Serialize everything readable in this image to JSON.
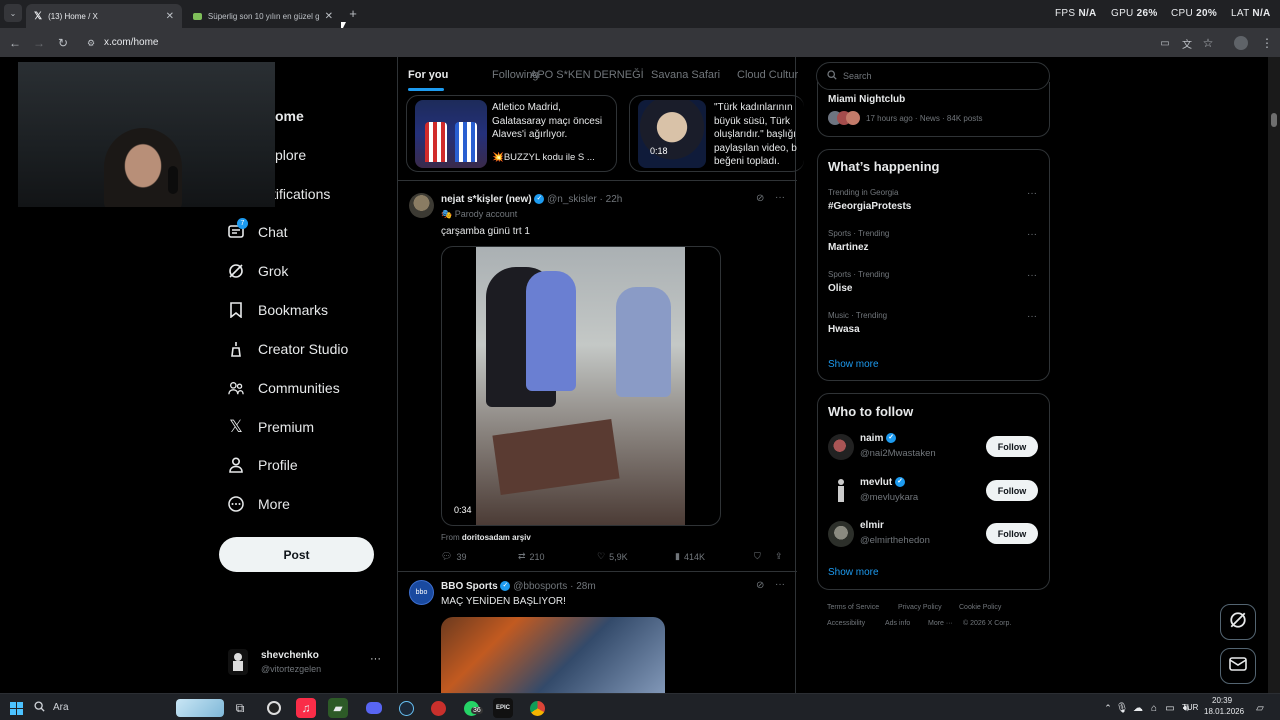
{
  "browser": {
    "tabs": [
      {
        "title": "(13) Home / X",
        "active": true
      },
      {
        "title": "Süperlig son 10 yılın en güzel g",
        "active": false
      }
    ],
    "new_tab": "+",
    "url": "x.com/home",
    "perf": {
      "fps_label": "FPS",
      "fps_value": "N/A",
      "gpu_label": "GPU",
      "gpu_value": "26%",
      "cpu_label": "CPU",
      "cpu_value": "20%",
      "lat_label": "LAT",
      "lat_value": "N/A"
    }
  },
  "nav": {
    "items": [
      {
        "label": "Home",
        "icon": "home-icon"
      },
      {
        "label": "Explore",
        "icon": "search-icon"
      },
      {
        "label": "Notifications",
        "icon": "bell-icon"
      },
      {
        "label": "Chat",
        "icon": "chat-icon"
      },
      {
        "label": "Grok",
        "icon": "grok-icon"
      },
      {
        "label": "Bookmarks",
        "icon": "bookmark-icon"
      },
      {
        "label": "Creator Studio",
        "icon": "creator-icon"
      },
      {
        "label": "Communities",
        "icon": "communities-icon"
      },
      {
        "label": "Premium",
        "icon": "x-logo-icon"
      },
      {
        "label": "Profile",
        "icon": "person-icon"
      },
      {
        "label": "More",
        "icon": "more-circle-icon"
      }
    ],
    "visible_labels": {
      "home": "ome",
      "explore": "plore",
      "notifications": "tifications"
    },
    "chat_badge": "7",
    "post_label": "Post",
    "account": {
      "name": "shevchenko",
      "handle": "@vitortezgelen"
    }
  },
  "feed": {
    "tabs": [
      "For you",
      "Following",
      "APO S*KEN DERNEĞİ",
      "Savana Safari",
      "Cloud Cultur"
    ],
    "cards": [
      {
        "text": "Atletico Madrid, Galatasaray maçı öncesi Alaves'i ağırlıyor.",
        "sub": "💥BUZZYL kodu ile S ..."
      },
      {
        "text": "\"Türk kadınlarının büyük süsü, Türk oluşlarıdır.\" başlığı paylaşılan video, b beğeni topladı.",
        "duration": "0:18"
      }
    ],
    "tweets": [
      {
        "name": "nejat s*kişler (new)",
        "handle": "@n_skisler",
        "time": "· 22h",
        "parody": "Parody account",
        "text": "çarşamba günü trt 1",
        "video_duration": "0:34",
        "from_label": "From",
        "from_user": "doritosadam arşiv",
        "replies": "39",
        "reposts": "210",
        "likes": "5,9K",
        "views": "414K"
      },
      {
        "name": "BBO Sports",
        "handle": "@bbosports",
        "time": "· 28m",
        "text": "MAÇ YENİDEN BAŞLIYOR!"
      }
    ]
  },
  "sidebar": {
    "search_placeholder": "Search",
    "news_top": {
      "title": "Miami Nightclub",
      "meta": "17 hours ago · News · 84K posts"
    },
    "happening_title": "What’s happening",
    "trends": [
      {
        "meta": "Trending in Georgia",
        "name": "#GeorgiaProtests"
      },
      {
        "meta": "Sports · Trending",
        "name": "Martinez"
      },
      {
        "meta": "Sports · Trending",
        "name": "Olise"
      },
      {
        "meta": "Music · Trending",
        "name": "Hwasa"
      }
    ],
    "show_more": "Show more",
    "who_to_follow_title": "Who to follow",
    "follow_suggestions": [
      {
        "name": "naim",
        "handle": "@nai2Mwastaken"
      },
      {
        "name": "mevlut",
        "handle": "@mevluykara"
      },
      {
        "name": "elmir",
        "handle": "@elmirthehedon"
      }
    ],
    "follow_label": "Follow",
    "footer": [
      "Terms of Service",
      "Privacy Policy",
      "Cookie Policy",
      "Accessibility",
      "Ads info",
      "More ···",
      "© 2026 X Corp."
    ]
  },
  "taskbar": {
    "search_placeholder": "Ara",
    "whatsapp_badge": "36",
    "lang": "TUR",
    "time": "20:39",
    "date": "18.01.2026"
  },
  "colors": {
    "accent": "#1d9bf0",
    "background": "#000000",
    "border": "#2f3336",
    "muted": "#71767b"
  }
}
